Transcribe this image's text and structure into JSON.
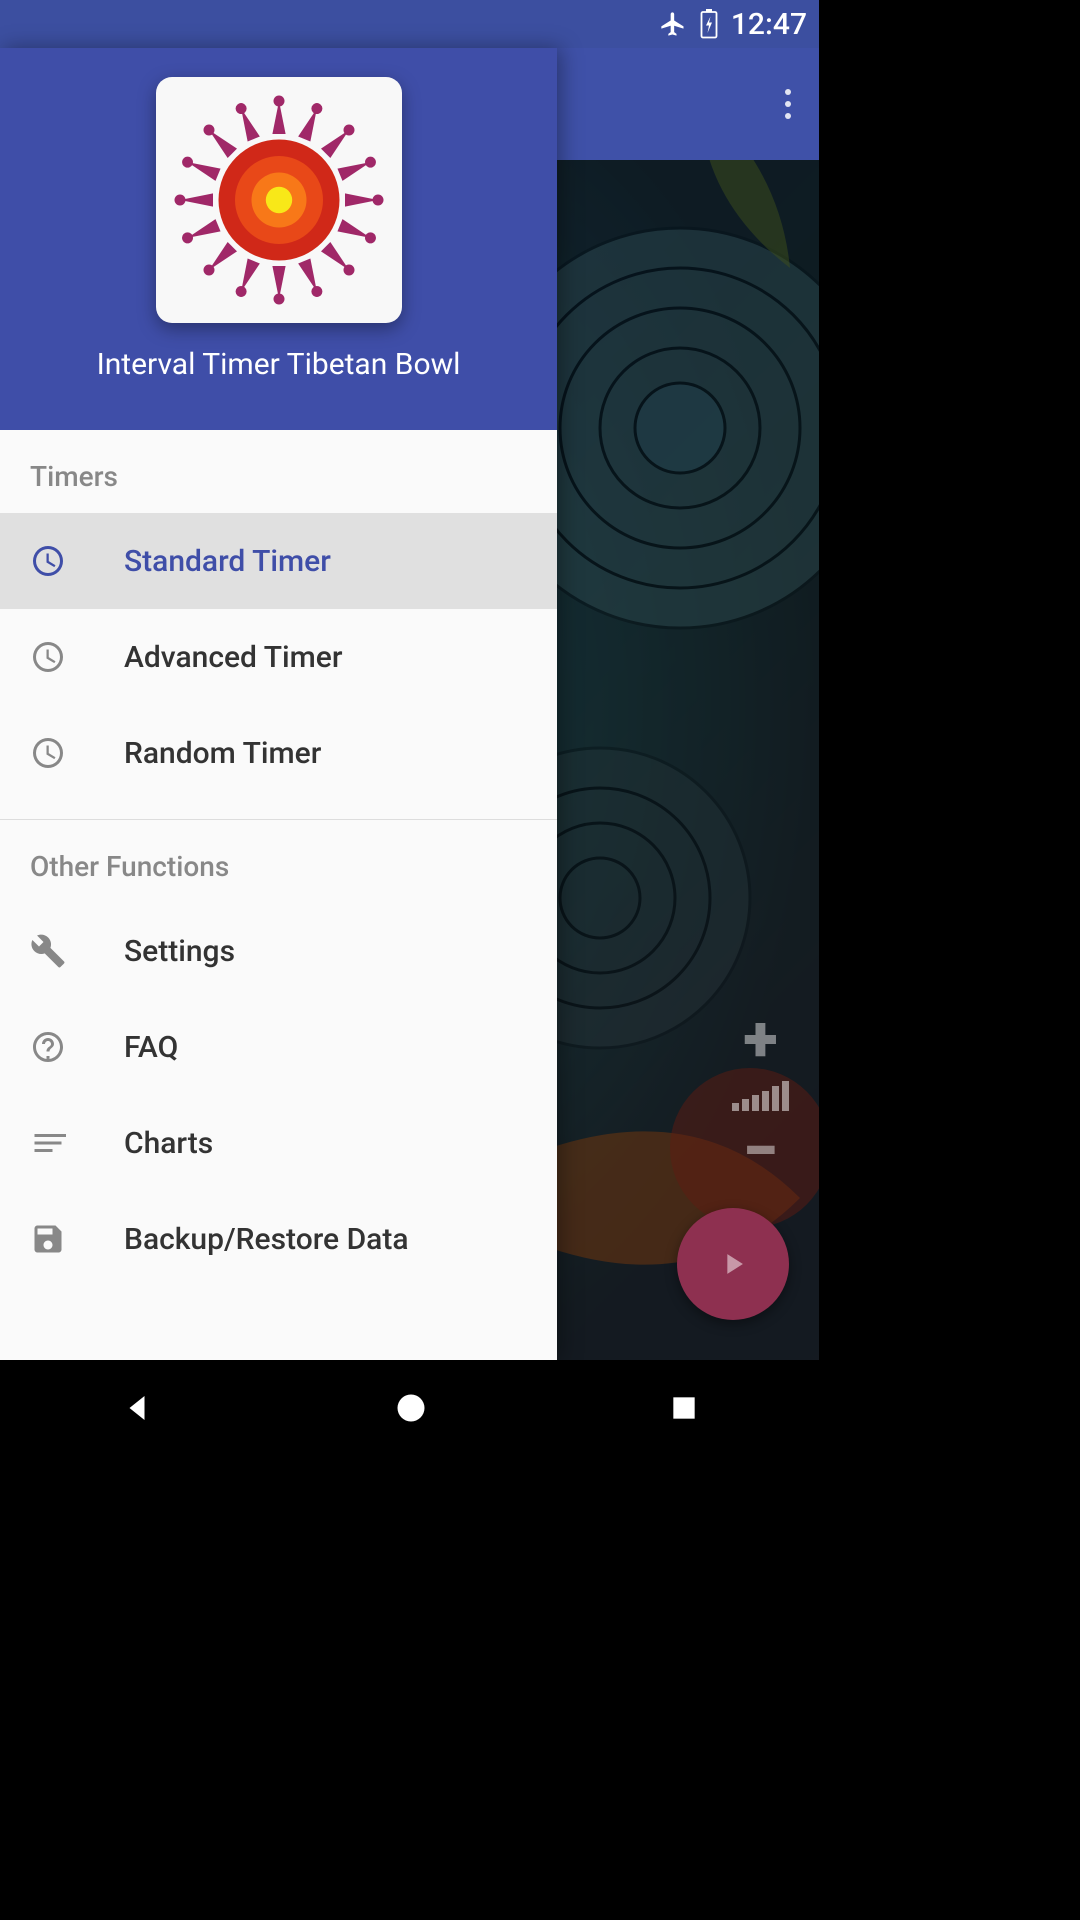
{
  "status": {
    "time": "12:47"
  },
  "app": {
    "title": "Interval Timer Tibetan Bowl"
  },
  "drawer": {
    "sections": [
      {
        "title": "Timers",
        "items": [
          {
            "label": "Standard Timer",
            "icon": "clock",
            "selected": true
          },
          {
            "label": "Advanced Timer",
            "icon": "clock",
            "selected": false
          },
          {
            "label": "Random Timer",
            "icon": "clock",
            "selected": false
          }
        ]
      },
      {
        "title": "Other Functions",
        "items": [
          {
            "label": "Settings",
            "icon": "wrench",
            "selected": false
          },
          {
            "label": "FAQ",
            "icon": "question",
            "selected": false
          },
          {
            "label": "Charts",
            "icon": "bars",
            "selected": false
          },
          {
            "label": "Backup/Restore Data",
            "icon": "save",
            "selected": false
          }
        ]
      }
    ]
  }
}
